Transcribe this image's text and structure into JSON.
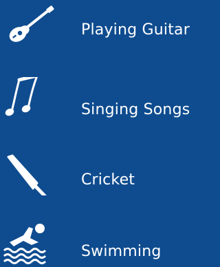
{
  "hobbies": [
    {
      "label": "Playing Guitar",
      "icon": "guitar-icon"
    },
    {
      "label": "Singing Songs",
      "icon": "music-note-icon"
    },
    {
      "label": "Cricket",
      "icon": "cricket-bat-icon"
    },
    {
      "label": "Swimming",
      "icon": "swimmer-icon"
    }
  ],
  "colors": {
    "background": "#0f4c8f",
    "foreground": "#ffffff"
  }
}
